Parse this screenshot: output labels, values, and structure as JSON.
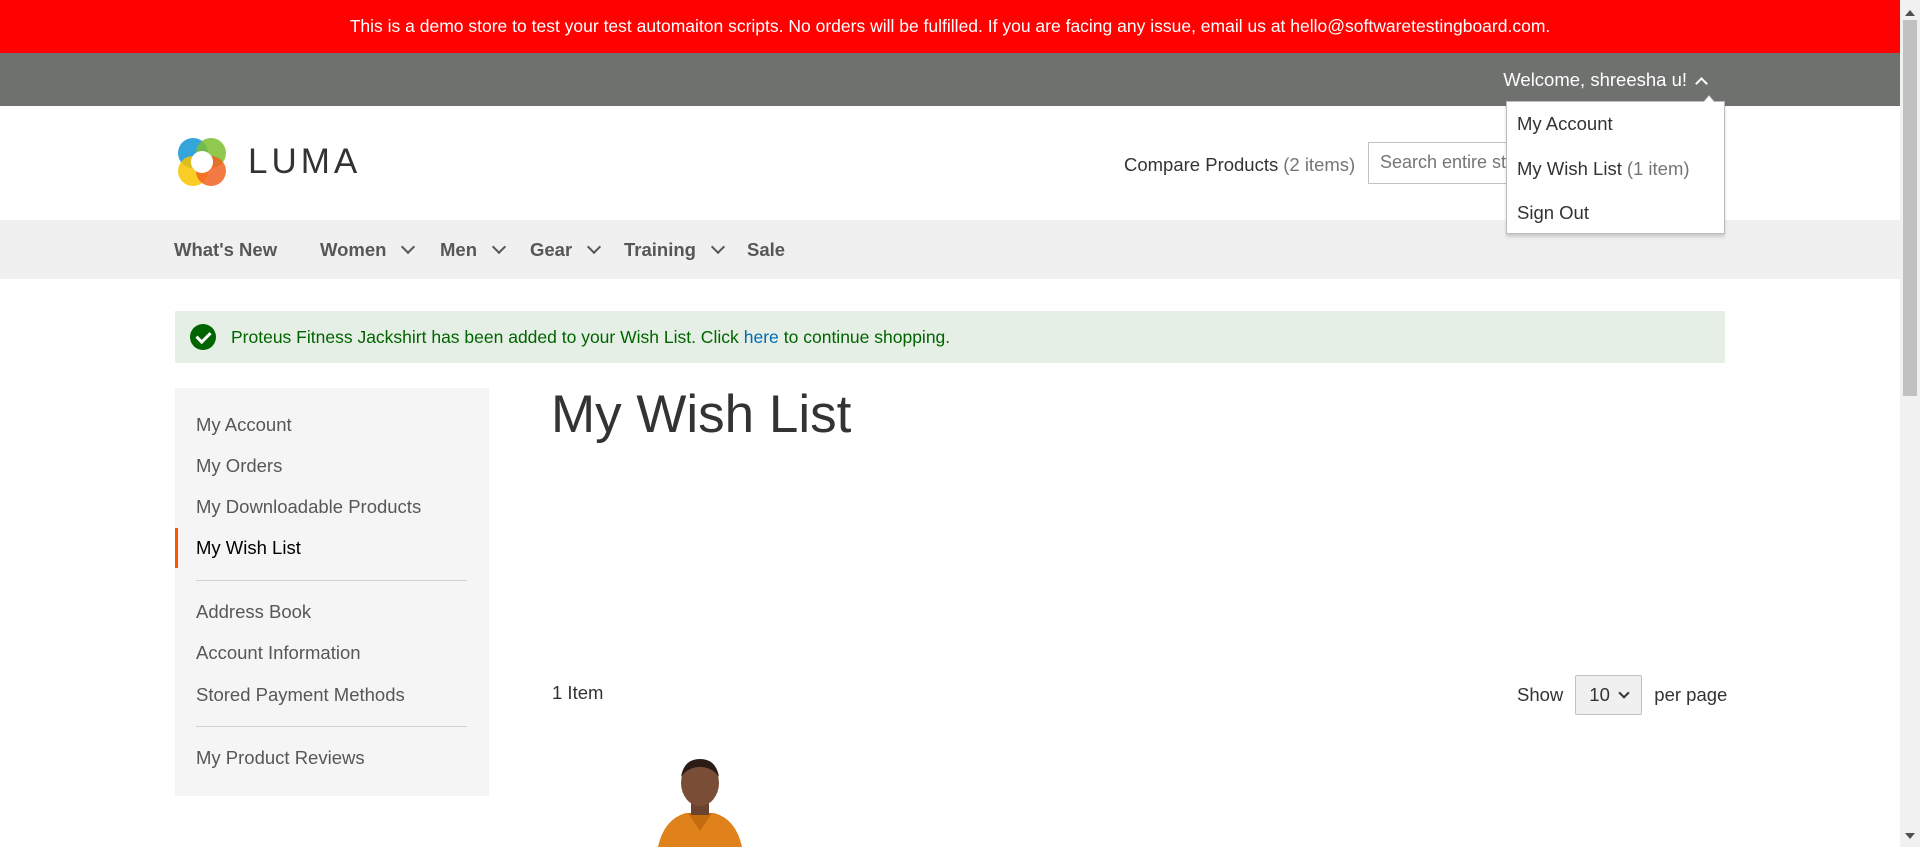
{
  "demo_notice": "This is a demo store to test your test automaiton scripts. No orders will be fulfilled. If you are facing any issue, email us at hello@softwaretestingboard.com.",
  "header": {
    "welcome": "Welcome, shreesha u!",
    "logo_text": "LUMA",
    "compare_label": "Compare Products",
    "compare_count": "(2 items)",
    "search_placeholder": "Search entire store here..."
  },
  "account_dropdown": {
    "items": [
      {
        "label": "My Account",
        "count": ""
      },
      {
        "label": "My Wish List",
        "count": "(1 item)"
      },
      {
        "label": "Sign Out",
        "count": ""
      }
    ]
  },
  "nav": {
    "items": [
      {
        "label": "What's New"
      },
      {
        "label": "Women"
      },
      {
        "label": "Men"
      },
      {
        "label": "Gear"
      },
      {
        "label": "Training"
      },
      {
        "label": "Sale"
      }
    ]
  },
  "message": {
    "before": "Proteus Fitness Jackshirt has been added to your Wish List. Click",
    "link": "here",
    "after": "to continue shopping."
  },
  "sidebar": {
    "items": [
      {
        "label": "My Account"
      },
      {
        "label": "My Orders"
      },
      {
        "label": "My Downloadable Products"
      },
      {
        "label": "My Wish List"
      },
      {
        "label": "Address Book"
      },
      {
        "label": "Account Information"
      },
      {
        "label": "Stored Payment Methods"
      },
      {
        "label": "My Product Reviews"
      }
    ]
  },
  "main": {
    "title": "My Wish List",
    "item_count": "1 Item",
    "show_label": "Show",
    "limit_value": "10",
    "per_page_label": "per page"
  },
  "colors": {
    "demo_bar": "#ff0101",
    "panel_header": "#6e716e",
    "message_bg": "#e5efe5",
    "message_text": "#006400",
    "link": "#006bb4",
    "current_nav_accent": "#ff5501"
  }
}
